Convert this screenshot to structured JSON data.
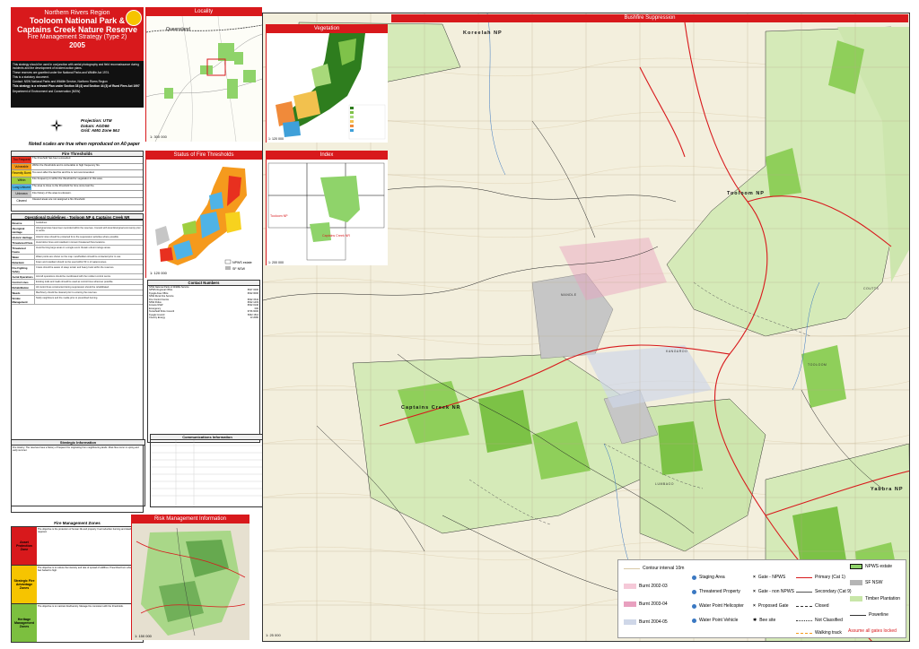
{
  "title": {
    "region": "Northern Rivers Region",
    "park": "Tooloom National Park &",
    "reserve": "Captains Creek Nature Reserve",
    "strategy": "Fire Management Strategy (Type 2)",
    "year": "2005"
  },
  "intro": {
    "p1": "This strategy should be used in conjunction with aerial photography and field reconnaissance during incidents and the development of incident action plans.",
    "p2": "These reserves are gazetted under the National Parks and Wildlife Act 1974.",
    "p3": "This is a statutory document.",
    "contact": "Contact: NSW National Parks and Wildlife Service, Northern Rivers Region",
    "cert": "This strategy is a relevant Plan under Section 38 (4) and Section 44 (3) of Rural Fires Act 1997",
    "dept": "Department of Environment and Conservation (NSW)"
  },
  "projection": {
    "projection": "Projection: UTM",
    "datum": "Datum: AGD66",
    "grid": "Grid: AMG Zone 56J"
  },
  "note": "Noted scales are true when reproduced on A0 paper",
  "fire_thresholds": {
    "heading": "Fire Thresholds",
    "rows": [
      {
        "label": "Too Frequent",
        "color": "#e8301f",
        "text": "The threshold has been exceeded."
      },
      {
        "label": "Vulnerable",
        "color": "#f59a1d",
        "text": "Within the thresholds and is vulnerable to high frequency fire."
      },
      {
        "label": "Recently Burnt",
        "color": "#f7d21e",
        "text": "Too soon after the last fire and fire is not recommended."
      },
      {
        "label": "Within Threshold",
        "color": "#9fcf3f",
        "text": "Fire frequency is within the threshold for vegetation in this area."
      },
      {
        "label": "Long Unburnt",
        "color": "#4fb3e6",
        "text": "The area is close to the threshold for time since last fire."
      },
      {
        "label": "Unknown",
        "color": "#c6c6c6",
        "text": "Fire history of the area is unknown."
      },
      {
        "label": "Cleared",
        "color": "#ffffff",
        "text": "Cleared areas are not assigned a fire threshold."
      }
    ]
  },
  "operational": {
    "heading": "Operational Guidelines - Tooloom NP & Captains Creek NR",
    "rows": [
      {
        "k": "Reserve",
        "v": "Guidelines"
      },
      {
        "k": "Aboriginal Heritage",
        "v": "Aboriginal sites have been recorded within the reserves. Consult with local Aboriginal community prior to works."
      },
      {
        "k": "Historic Heritage",
        "v": "Historic sites should be protected from fire suppression activities where possible."
      },
      {
        "k": "Threatened Flora",
        "v": "Avoid dozer lines and retardant in known threatened flora locations."
      },
      {
        "k": "Threatened Fauna",
        "v": "Avoid burning large areas in a single event. Retain unburnt refuge areas."
      },
      {
        "k": "Water",
        "v": "Water points are shown on the map. Landholders should be contacted prior to use."
      },
      {
        "k": "Retardant",
        "v": "Foam and retardant should not be used within 50 m of watercourses."
      },
      {
        "k": "Fire Fighting Safety",
        "v": "Crews should be aware of steep terrain and heavy fuels within the reserves."
      },
      {
        "k": "Aerial Operations",
        "v": "Aircraft operations should be coordinated with the incident control centre."
      },
      {
        "k": "Control Lines",
        "v": "Existing trails and roads should be used as control lines wherever possible."
      },
      {
        "k": "Rehabilitation",
        "v": "All control lines constructed during suppression should be rehabilitated."
      },
      {
        "k": "Weeds",
        "v": "Machinery should be cleaned prior to entering the reserves."
      },
      {
        "k": "Smoke Management",
        "v": "Notify neighbours and the media prior to prescribed burning."
      }
    ]
  },
  "fire_zones": {
    "heading": "Fire Management Zones",
    "rows": [
      {
        "zone": "Asset Protection Zone",
        "color": "#d8191c",
        "text": "The objective is the protection of human life and property. Fuel reduction burning and slashing as required."
      },
      {
        "zone": "Strategic Fire Advantage Zones",
        "color": "#f6c400",
        "text": "The objective is to reduce the intensity and rate of spread of wildfires. Prescribed burn when overall fuel hazard is high."
      },
      {
        "zone": "Heritage Management Zones",
        "color": "#7cbf3f",
        "text": "The objective is to maintain biodiversity. Manage fire consistent with the thresholds."
      }
    ]
  },
  "locality": {
    "title": "Locality",
    "state_label": "Queensland",
    "scale": "1: 300 000"
  },
  "status": {
    "title": "Status of Fire Thresholds",
    "scale": "1: 120 000",
    "legend_nparks": "NPWS estate",
    "legend_sf": "SF NSW"
  },
  "vegetation": {
    "title": "Vegetation",
    "scale": "1: 120 000"
  },
  "index": {
    "title": "Index",
    "scale": "1: 200 000",
    "label_1": "Tooloom NP",
    "label_2": "Captains Creek NR"
  },
  "contacts": {
    "heading": "Contact Numbers",
    "rows": [
      {
        "n": "NSW National Parks & Wildlife Service",
        "p": ""
      },
      {
        "n": "NPWS Regional Office",
        "p": "6627 0200"
      },
      {
        "n": "Kyogle Area Office",
        "p": "6632 0000"
      },
      {
        "n": "NSW Rural Fire Service",
        "p": ""
      },
      {
        "n": "Fire Control Centre",
        "p": "6632 1544"
      },
      {
        "n": "NSW Police",
        "p": "6632 1433"
      },
      {
        "n": "Forests NSW",
        "p": "6632 0140"
      },
      {
        "n": "Emergency",
        "p": "000"
      },
      {
        "n": "Tenterfield Shire Council",
        "p": "6736 6000"
      },
      {
        "n": "Kyogle Council",
        "p": "6632 1611"
      },
      {
        "n": "Country Energy",
        "p": "13 2080"
      }
    ]
  },
  "comms": {
    "heading": "Communications Information"
  },
  "strategic": {
    "heading": "Strategic Information",
    "text": "Fire History: The reserves have a history of frequent fire originating from neighbouring lands. Most fires occur in spring and early summer."
  },
  "risk": {
    "title": "Risk Management Information",
    "scale": "1: 150 000"
  },
  "main_map": {
    "title": "Bushfire Suppression",
    "scale": "1: 25 000",
    "labels": {
      "koreelah": "Koreelah NP",
      "tooloom": "Tooloom NP",
      "captains": "Captains Creek NR",
      "yabbra": "Yabbra NP",
      "mandle": "MANDLE",
      "kangaroo": "KANGAROO",
      "lumbago": "LUMBAGO",
      "coutts": "COUTTS",
      "tooloom_place": "TOOLOOM"
    }
  },
  "legend": {
    "contour": "Contour interval 10m",
    "burnt1": "Burnt 2002-03",
    "burnt2": "Burnt 2003-04",
    "burnt3": "Burnt 2004-05",
    "staging": "Staging Area",
    "threatened": "Threatened Property",
    "heli": "Water Point Helicopter",
    "vehicle": "Water Point Vehicle",
    "gate_npws": "Gate - NPWS",
    "gate_non": "Gate - non NPWS",
    "proposed": "Proposed Gate",
    "bee": "Bee site",
    "primary": "Primary (Cat 1)",
    "secondary": "Secondary (Cat 9)",
    "closed": "Closed",
    "not_class": "Not Classified",
    "walking": "Walking track",
    "npws": "NPWS estate",
    "sfnsw": "SF NSW",
    "timber": "Timber Plantation",
    "power": "Powerline",
    "assume": "Assume all gates locked",
    "colors": {
      "primary": "#d8191c",
      "burnt1": "#f5c9d8",
      "burnt2": "#e8a0bf",
      "burnt3": "#cfd7e8",
      "npws": "#8fd36a",
      "sf": "#b5b5b5"
    }
  }
}
